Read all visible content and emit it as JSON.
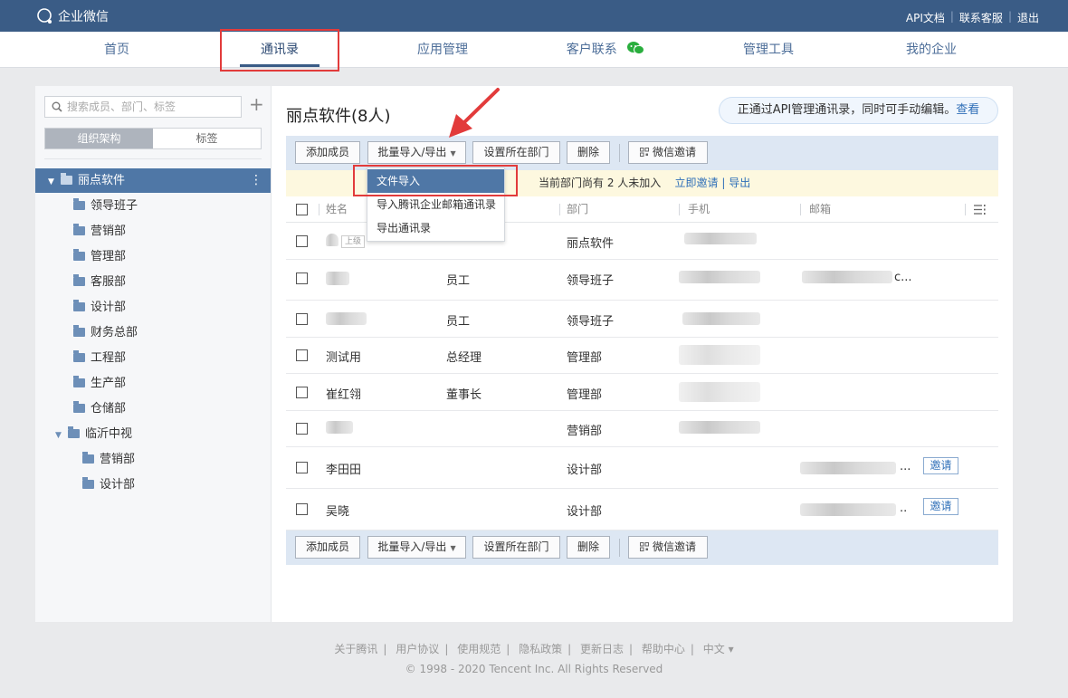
{
  "topbar": {
    "brand": "企业微信",
    "links": [
      "API文档",
      "联系客服",
      "退出"
    ]
  },
  "nav": {
    "items": [
      "首页",
      "通讯录",
      "应用管理",
      "客户联系",
      "管理工具",
      "我的企业"
    ],
    "active": "通讯录"
  },
  "sidebar": {
    "search_placeholder": "搜索成员、部门、标签",
    "tabs": [
      "组织架构",
      "标签"
    ],
    "root": "丽点软件",
    "departments": [
      "领导班子",
      "营销部",
      "管理部",
      "客服部",
      "设计部",
      "财务总部",
      "工程部",
      "生产部",
      "仓储部"
    ],
    "branch": "临沂中视",
    "branch_children": [
      "营销部",
      "设计部"
    ]
  },
  "main": {
    "title": "丽点软件(8人)",
    "api_note": "正通过API管理通讯录，同时可手动编辑。",
    "api_note_link": "查看",
    "toolbar": {
      "add_member": "添加成员",
      "batch_import_export": "批量导入/导出",
      "set_department": "设置所在部门",
      "delete": "删除",
      "wechat_invite": "微信邀请"
    },
    "notice": {
      "text": "当前部门尚有 2 人未加入",
      "invite_now": "立即邀请",
      "export": "导出"
    },
    "columns": [
      "姓名",
      "部门",
      "手机",
      "邮箱"
    ],
    "dropdown": [
      "文件导入",
      "导入腾讯企业邮箱通讯录",
      "导出通讯录"
    ],
    "superior_badge": "上级",
    "rows": [
      {
        "name": "",
        "position": "",
        "department": "丽点软件",
        "email_suffix": "",
        "invite": ""
      },
      {
        "name": "",
        "position": "员工",
        "department": "领导班子",
        "email_suffix": "c...",
        "invite": ""
      },
      {
        "name": "",
        "position": "员工",
        "department": "领导班子",
        "email_suffix": "",
        "invite": ""
      },
      {
        "name": "测试用",
        "position": "总经理",
        "department": "管理部",
        "email_suffix": "",
        "invite": ""
      },
      {
        "name": "崔红翎",
        "position": "董事长",
        "department": "管理部",
        "email_suffix": "",
        "invite": ""
      },
      {
        "name": "",
        "position": "",
        "department": "营销部",
        "email_suffix": "",
        "invite": ""
      },
      {
        "name": "李田田",
        "position": "",
        "department": "设计部",
        "email_suffix": "...",
        "invite": "邀请"
      },
      {
        "name": "吴晓",
        "position": "",
        "department": "设计部",
        "email_suffix": "..",
        "invite": "邀请"
      }
    ]
  },
  "footer": {
    "links": [
      "关于腾讯",
      "用户协议",
      "使用规范",
      "隐私政策",
      "更新日志",
      "帮助中心",
      "中文 ▾"
    ],
    "copyright": "© 1998 - 2020 Tencent Inc. All Rights Reserved"
  },
  "colors": {
    "header": "#3a5c86",
    "accent": "#4f77a6",
    "highlight": "#e23b3b",
    "link": "#2f6fb8"
  }
}
